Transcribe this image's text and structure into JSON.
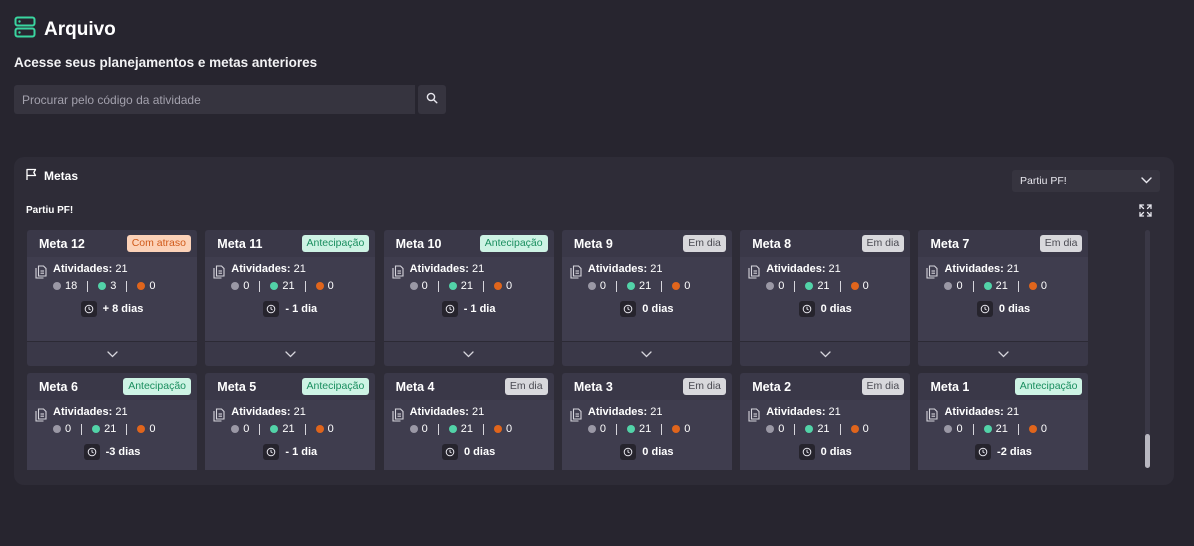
{
  "header": {
    "title": "Arquivo",
    "subtitle": "Acesse seus planejamentos e metas anteriores",
    "icon": "server-icon",
    "accent": "#3ad6a0"
  },
  "search": {
    "placeholder": "Procurar pelo código da atividade"
  },
  "panel": {
    "title": "Metas",
    "filter_value": "Partiu PF!",
    "group_label": "Partiu PF!",
    "activities_label": "Atividades:",
    "cards": [
      {
        "title": "Meta 12",
        "status": "Com atraso",
        "status_kind": "late",
        "activities": "21",
        "gray": "18",
        "teal": "3",
        "orange": "0",
        "days": "+ 8 dias"
      },
      {
        "title": "Meta 11",
        "status": "Antecipação",
        "status_kind": "ant",
        "activities": "21",
        "gray": "0",
        "teal": "21",
        "orange": "0",
        "days": "- 1 dia"
      },
      {
        "title": "Meta 10",
        "status": "Antecipação",
        "status_kind": "ant",
        "activities": "21",
        "gray": "0",
        "teal": "21",
        "orange": "0",
        "days": "- 1 dia"
      },
      {
        "title": "Meta 9",
        "status": "Em dia",
        "status_kind": "ok",
        "activities": "21",
        "gray": "0",
        "teal": "21",
        "orange": "0",
        "days": "0 dias"
      },
      {
        "title": "Meta 8",
        "status": "Em dia",
        "status_kind": "ok",
        "activities": "21",
        "gray": "0",
        "teal": "21",
        "orange": "0",
        "days": "0 dias"
      },
      {
        "title": "Meta 7",
        "status": "Em dia",
        "status_kind": "ok",
        "activities": "21",
        "gray": "0",
        "teal": "21",
        "orange": "0",
        "days": "0 dias"
      },
      {
        "title": "Meta 6",
        "status": "Antecipação",
        "status_kind": "ant",
        "activities": "21",
        "gray": "0",
        "teal": "21",
        "orange": "0",
        "days": "-3 dias"
      },
      {
        "title": "Meta 5",
        "status": "Antecipação",
        "status_kind": "ant",
        "activities": "21",
        "gray": "0",
        "teal": "21",
        "orange": "0",
        "days": "- 1 dia"
      },
      {
        "title": "Meta 4",
        "status": "Em dia",
        "status_kind": "ok",
        "activities": "21",
        "gray": "0",
        "teal": "21",
        "orange": "0",
        "days": "0 dias"
      },
      {
        "title": "Meta 3",
        "status": "Em dia",
        "status_kind": "ok",
        "activities": "21",
        "gray": "0",
        "teal": "21",
        "orange": "0",
        "days": "0 dias"
      },
      {
        "title": "Meta 2",
        "status": "Em dia",
        "status_kind": "ok",
        "activities": "21",
        "gray": "0",
        "teal": "21",
        "orange": "0",
        "days": "0 dias"
      },
      {
        "title": "Meta 1",
        "status": "Antecipação",
        "status_kind": "ant",
        "activities": "21",
        "gray": "0",
        "teal": "21",
        "orange": "0",
        "days": "-2 dias"
      }
    ]
  },
  "colors": {
    "gray_dot": "#9a98a5",
    "teal_dot": "#52d3a8",
    "orange_dot": "#e0651c"
  }
}
